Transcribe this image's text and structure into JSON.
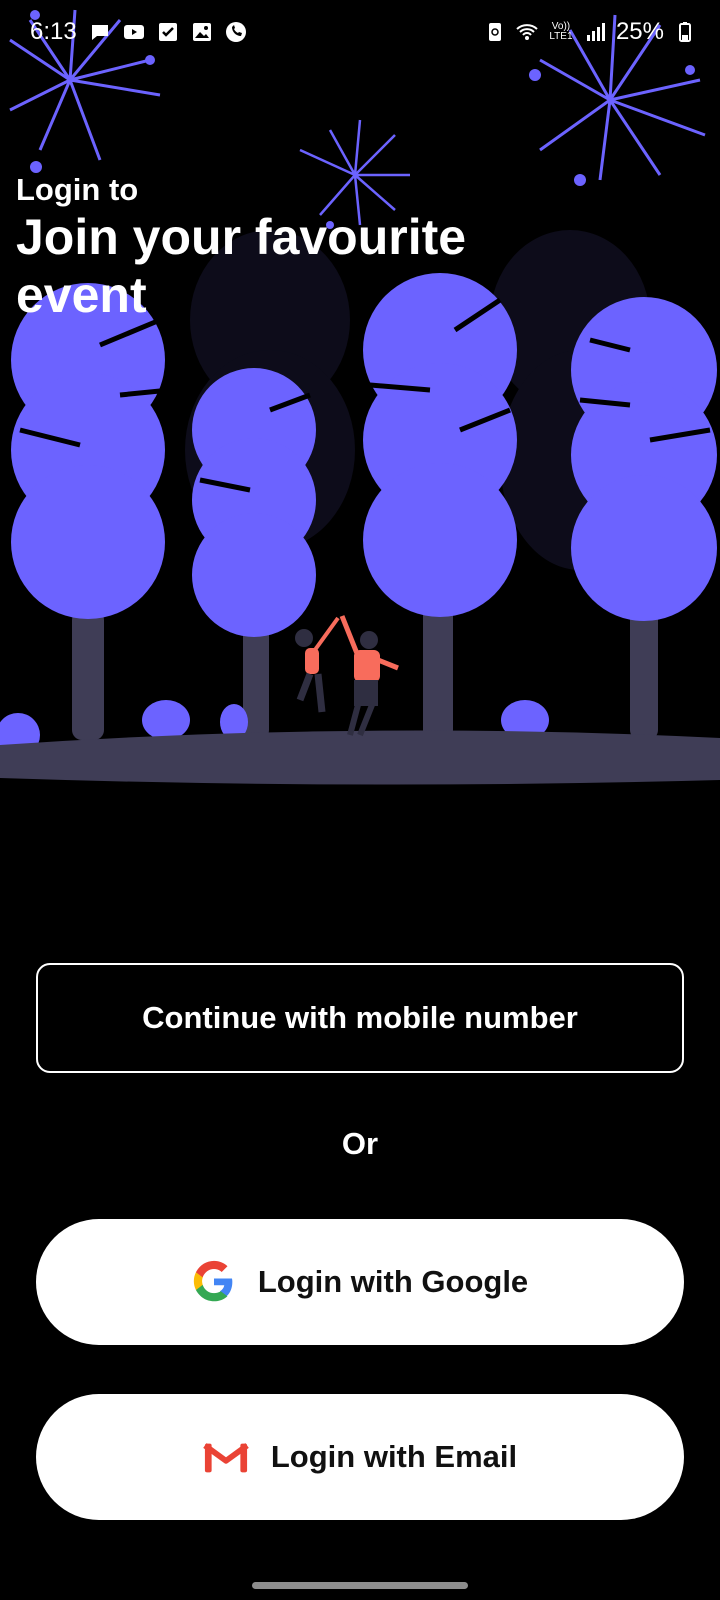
{
  "status_bar": {
    "time": "6:13",
    "battery": "25%",
    "network_label": "Vo)) LTE1"
  },
  "heading": {
    "subtitle": "Login to",
    "title": "Join your favourite event"
  },
  "actions": {
    "mobile_label": "Continue with mobile number",
    "divider": "Or",
    "google_label": "Login with Google",
    "email_label": "Login with Email"
  },
  "colors": {
    "background": "#000000",
    "tree": "#6C63FF",
    "ground": "#3F3D56",
    "person": "#F86C5C"
  },
  "icons": [
    "chat-icon",
    "youtube-icon",
    "check-icon",
    "gallery-icon",
    "phone-icon",
    "recycle-icon",
    "wifi-icon",
    "signal-icon",
    "battery-icon",
    "google-icon",
    "gmail-icon"
  ]
}
